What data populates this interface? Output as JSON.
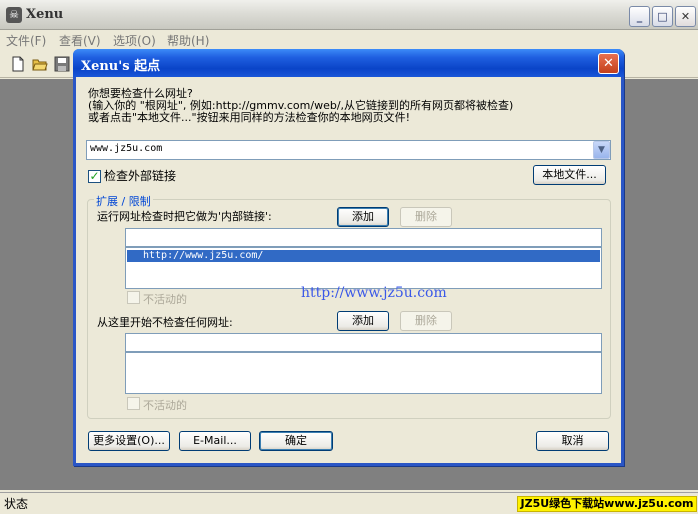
{
  "window": {
    "title": "Xenu",
    "icon": "skull-icon",
    "min_symbol": "_",
    "max_symbol": "□",
    "close_symbol": "✕"
  },
  "menu": [
    {
      "label": "文件(F)"
    },
    {
      "label": "查看(V)"
    },
    {
      "label": "选项(O)"
    },
    {
      "label": "帮助(H)"
    }
  ],
  "toolbar": {
    "icons": [
      "new-file-icon",
      "open-folder-icon",
      "save-icon"
    ]
  },
  "dialog": {
    "title": "Xenu's 起点",
    "close_symbol": "✕",
    "intro_line1": "你想要检查什么网址?",
    "intro_line2": "(输入你的 \"根网址\", 例如:http://gmmv.com/web/,从它链接到的所有网页都将被检查)",
    "intro_line3": "或者点击\"本地文件...\"按钮来用同样的方法检查你的本地网页文件!",
    "url_value": "www.jz5u.com",
    "check_external_label": "检查外部链接",
    "check_external_checked": true,
    "local_file_button": "本地文件...",
    "group_label": "扩展 / 限制",
    "internal_label": "运行网址检查时把它做为'内部链接':",
    "internal_add": "添加",
    "internal_delete": "删除",
    "internal_items": [
      "http://www.jz5u.com/"
    ],
    "inactive_label_1": "不活动的",
    "exclude_label": "从这里开始不检查任何网址:",
    "exclude_add": "添加",
    "exclude_delete": "删除",
    "inactive_label_2": "不活动的",
    "more_settings_button": "更多设置(O)...",
    "email_button": "E-Mail...",
    "ok_button": "确定",
    "cancel_button": "取消",
    "url_watermark": "http://www.jz5u.com"
  },
  "status": {
    "text": "状态",
    "badge": "JZ5U绿色下载站www.jz5u.com"
  },
  "colors": {
    "dialog_title_blue": "#0a44c8",
    "selection_blue": "#316ac5",
    "group_label_blue": "#0046d5",
    "watermark_yellow": "#fff200"
  }
}
